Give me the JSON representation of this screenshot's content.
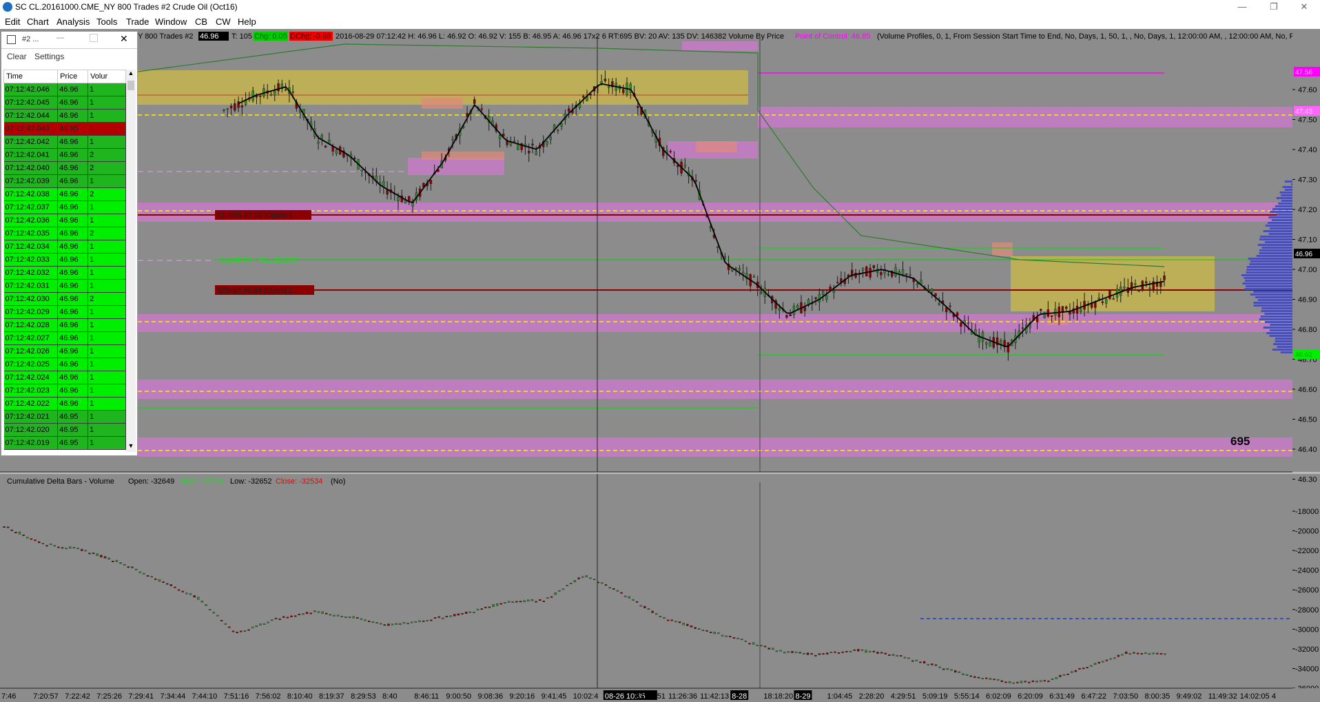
{
  "window": {
    "title": "SC CL.20161000.CME_NY  800 Trades  #2  Crude Oil (Oct16)",
    "buttons": [
      "—",
      "❐",
      "✕"
    ]
  },
  "menu": [
    "Edit",
    "Chart",
    "Analysis",
    "Tools",
    "Trade",
    "Window",
    "CB",
    "CW",
    "Help"
  ],
  "chart_header": {
    "prefix": "Y  800 Trades  #2",
    "last": "46.96",
    "tick": "T: 105",
    "chg": "Chg: 0.05",
    "dchg": "DChg: -0.68",
    "info": "2016-08-29  07:12:42 H: 46.96  L: 46.92  O: 46.92  V: 155  B: 46.95  A: 46.96  17x2 6  RT:695  BV: 20  AV: 135  DV: 146382  Volume By Price",
    "poc": "Point of Control: 46.85",
    "study": "(Volume Profiles, 0, 1, From Session Start Time to End, No, Days, 1, 50, 1, , No, Days, 1, 12:00:00 AM, , 12:00:00 AM, No, Perio"
  },
  "price_axis": [
    "47.60",
    "47.50",
    "47.40",
    "47.30",
    "47.20",
    "47.10",
    "47.00",
    "46.90",
    "46.80",
    "46.70",
    "46.60",
    "46.50",
    "46.40",
    "46.30"
  ],
  "price_tags": [
    {
      "label": "47.56",
      "color": "#ff00ff"
    },
    {
      "label": "47.43",
      "color": "#ff66ff"
    },
    {
      "label": "46.96",
      "color": "#000000"
    },
    {
      "label": "46.62",
      "color": "#00cc00"
    }
  ],
  "orders": {
    "stop_upper": "S|Limit| 47.09 |Open| 1",
    "position": "+1@46.94 | P/L: 20.00C",
    "stop_lower": "S|Stop| 46.84 |Open| 1"
  },
  "trade_count": "695",
  "lower_pane": {
    "title": "Cumulative Delta Bars - Volume",
    "open": "Open: -32649",
    "high": "High: -32534",
    "low": "Low: -32652",
    "close": "Close: -32534",
    "no": "(No)",
    "axis": [
      "-18000",
      "-20000",
      "-22000",
      "-24000",
      "-26000",
      "-28000",
      "-30000",
      "-32000",
      "-34000",
      "-36000"
    ]
  },
  "time_axis": [
    "7:46",
    "7:20:57",
    "7:22:42",
    "7:25:26",
    "7:29:41",
    "7:34:44",
    "7:44:10",
    "7:51:16",
    "7:56:02",
    "8:10:40",
    "8:19:37",
    "8:29:53",
    "8:40",
    "8:46:11",
    "9:00:50",
    "9:08:36",
    "9:20:16",
    "9:41:45",
    "10:02:4",
    "08-26  10:35",
    "11:10:51",
    "11:26:36",
    "11:42:13",
    "8-28",
    "18:18:20",
    "8-29",
    "1:04:45",
    "2:28:20",
    "4:29:51",
    "5:09:19",
    "5:55:14",
    "6:02:09",
    "6:20:09",
    "6:31:49",
    "6:47:22",
    "7:03:50",
    "8:00:35",
    "9:49:02",
    "11:49:32",
    "14:02:05",
    "4"
  ],
  "tas": {
    "title": "#2 ...",
    "toolbar": [
      "Clear",
      "Settings"
    ],
    "columns": [
      "Time",
      "Price",
      "Volur"
    ],
    "rows": [
      {
        "time": "07:12:42.046",
        "price": "46.96",
        "vol": "1",
        "kind": "rd"
      },
      {
        "time": "07:12:42.045",
        "price": "46.96",
        "vol": "1",
        "kind": "rd"
      },
      {
        "time": "07:12:42.044",
        "price": "46.96",
        "vol": "1",
        "kind": "rd"
      },
      {
        "time": "07:12:42.043",
        "price": "46.95",
        "vol": "1",
        "kind": "rr"
      },
      {
        "time": "07:12:42.042",
        "price": "46.96",
        "vol": "1",
        "kind": "rd"
      },
      {
        "time": "07:12:42.041",
        "price": "46.96",
        "vol": "2",
        "kind": "rd"
      },
      {
        "time": "07:12:42.040",
        "price": "46.96",
        "vol": "2",
        "kind": "rd"
      },
      {
        "time": "07:12:42.039",
        "price": "46.96",
        "vol": "1",
        "kind": "rd"
      },
      {
        "time": "07:12:42.038",
        "price": "46.96",
        "vol": "2",
        "kind": "rg"
      },
      {
        "time": "07:12:42.037",
        "price": "46.96",
        "vol": "1",
        "kind": "rg"
      },
      {
        "time": "07:12:42.036",
        "price": "46.96",
        "vol": "1",
        "kind": "rg"
      },
      {
        "time": "07:12:42.035",
        "price": "46.96",
        "vol": "2",
        "kind": "rg"
      },
      {
        "time": "07:12:42.034",
        "price": "46.96",
        "vol": "1",
        "kind": "rg"
      },
      {
        "time": "07:12:42.033",
        "price": "46.96",
        "vol": "1",
        "kind": "rg"
      },
      {
        "time": "07:12:42.032",
        "price": "46.96",
        "vol": "1",
        "kind": "rg"
      },
      {
        "time": "07:12:42.031",
        "price": "46.96",
        "vol": "1",
        "kind": "rg"
      },
      {
        "time": "07:12:42.030",
        "price": "46.96",
        "vol": "2",
        "kind": "rg"
      },
      {
        "time": "07:12:42.029",
        "price": "46.96",
        "vol": "1",
        "kind": "rg"
      },
      {
        "time": "07:12:42.028",
        "price": "46.96",
        "vol": "1",
        "kind": "rg"
      },
      {
        "time": "07:12:42.027",
        "price": "46.96",
        "vol": "1",
        "kind": "rg"
      },
      {
        "time": "07:12:42.026",
        "price": "46.96",
        "vol": "1",
        "kind": "rg"
      },
      {
        "time": "07:12:42.025",
        "price": "46.96",
        "vol": "1",
        "kind": "rg"
      },
      {
        "time": "07:12:42.024",
        "price": "46.96",
        "vol": "1",
        "kind": "rg"
      },
      {
        "time": "07:12:42.023",
        "price": "46.96",
        "vol": "1",
        "kind": "rg"
      },
      {
        "time": "07:12:42.022",
        "price": "46.96",
        "vol": "1",
        "kind": "rg"
      },
      {
        "time": "07:12:42.021",
        "price": "46.95",
        "vol": "1",
        "kind": "rd"
      },
      {
        "time": "07:12:42.020",
        "price": "46.95",
        "vol": "1",
        "kind": "rd"
      },
      {
        "time": "07:12:42.019",
        "price": "46.95",
        "vol": "1",
        "kind": "rd"
      }
    ]
  },
  "chart_data": {
    "type": "line",
    "series": [
      {
        "values": [
          47.53,
          47.58,
          47.61,
          47.44,
          47.38,
          47.28,
          47.22,
          47.36,
          47.55,
          47.43,
          47.4,
          47.52,
          47.62,
          47.6,
          47.4,
          47.3,
          47.02,
          46.95,
          46.85,
          46.9,
          46.98,
          47.0,
          46.97,
          46.88,
          46.78,
          46.74,
          46.85,
          46.86,
          46.9,
          46.94,
          46.96
        ]
      },
      {
        "values": [
          -19500,
          -21300,
          -21900,
          -23200,
          -25000,
          -26800,
          -30400,
          -29000,
          -28200,
          -28800,
          -29600,
          -29000,
          -28300,
          -27200,
          -27000,
          -24500,
          -26400,
          -28800,
          -30000,
          -31000,
          -32200,
          -32600,
          -32100,
          -32600,
          -33600,
          -34800,
          -35400,
          -35200,
          -33800,
          -32400,
          -32534
        ]
      }
    ],
    "colors": {
      "background": "#8c8c8c",
      "up": "#2e8b2e",
      "down": "#8b0000",
      "vwap": "#2f7a2f",
      "ma": "#000000",
      "zone": "#c8b84a",
      "hvn": "#c070c0",
      "delta_ref": "#1b3cc8"
    }
  }
}
